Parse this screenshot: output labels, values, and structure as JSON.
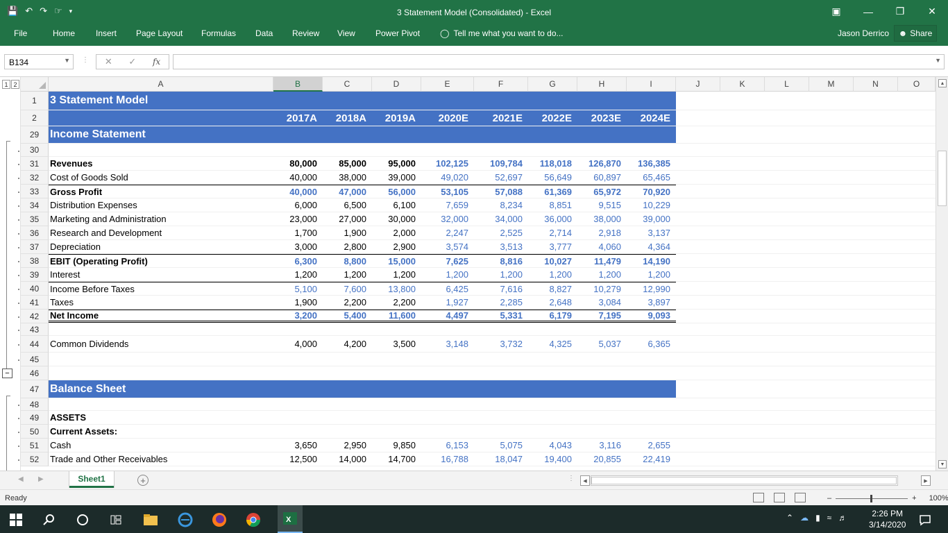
{
  "window": {
    "title": "3 Statement Model (Consolidated)  -  Excel",
    "username": "Jason Derrico",
    "share_label": "Share"
  },
  "ribbon": {
    "tabs": [
      "File",
      "Home",
      "Insert",
      "Page Layout",
      "Formulas",
      "Data",
      "Review",
      "View",
      "Power Pivot"
    ],
    "tell_me": "Tell me what you want to do..."
  },
  "formula_bar": {
    "name_box": "B134",
    "formula": "",
    "fx_label": "fx"
  },
  "outline_levels": [
    "1",
    "2"
  ],
  "columns": [
    "A",
    "B",
    "C",
    "D",
    "E",
    "F",
    "G",
    "H",
    "I",
    "J",
    "K",
    "L",
    "M",
    "N",
    "O"
  ],
  "selected_column": "B",
  "years": [
    "2017A",
    "2018A",
    "2019A",
    "2020E",
    "2021E",
    "2022E",
    "2023E",
    "2024E"
  ],
  "rows": [
    {
      "num": "1",
      "label": "3 Statement Model",
      "kind": "title"
    },
    {
      "num": "2",
      "label": "",
      "kind": "years"
    },
    {
      "num": "29",
      "label": "Income Statement",
      "kind": "section"
    },
    {
      "num": "30",
      "label": "",
      "kind": "blank"
    },
    {
      "num": "31",
      "label": "Revenues",
      "kind": "data",
      "bold": true,
      "values": [
        "80,000",
        "85,000",
        "95,000",
        "102,125",
        "109,784",
        "118,018",
        "126,870",
        "136,385"
      ]
    },
    {
      "num": "32",
      "label": "Cost of Goods Sold",
      "kind": "data",
      "values": [
        "40,000",
        "38,000",
        "39,000",
        "49,020",
        "52,697",
        "56,649",
        "60,897",
        "65,465"
      ]
    },
    {
      "num": "33",
      "label": "Gross Profit",
      "kind": "data",
      "bold": true,
      "subtotal": true,
      "values": [
        "40,000",
        "47,000",
        "56,000",
        "53,105",
        "57,088",
        "61,369",
        "65,972",
        "70,920"
      ]
    },
    {
      "num": "34",
      "label": "Distribution Expenses",
      "kind": "data",
      "values": [
        "6,000",
        "6,500",
        "6,100",
        "7,659",
        "8,234",
        "8,851",
        "9,515",
        "10,229"
      ]
    },
    {
      "num": "35",
      "label": "Marketing and Administration",
      "kind": "data",
      "values": [
        "23,000",
        "27,000",
        "30,000",
        "32,000",
        "34,000",
        "36,000",
        "38,000",
        "39,000"
      ]
    },
    {
      "num": "36",
      "label": "Research and Development",
      "kind": "data",
      "values": [
        "1,700",
        "1,900",
        "2,000",
        "2,247",
        "2,525",
        "2,714",
        "2,918",
        "3,137"
      ]
    },
    {
      "num": "37",
      "label": "Depreciation",
      "kind": "data",
      "values": [
        "3,000",
        "2,800",
        "2,900",
        "3,574",
        "3,513",
        "3,777",
        "4,060",
        "4,364"
      ]
    },
    {
      "num": "38",
      "label": "EBIT (Operating Profit)",
      "kind": "data",
      "bold": true,
      "subtotal": true,
      "values": [
        "6,300",
        "8,800",
        "15,000",
        "7,625",
        "8,816",
        "10,027",
        "11,479",
        "14,190"
      ]
    },
    {
      "num": "39",
      "label": "Interest",
      "kind": "data",
      "values": [
        "1,200",
        "1,200",
        "1,200",
        "1,200",
        "1,200",
        "1,200",
        "1,200",
        "1,200"
      ]
    },
    {
      "num": "40",
      "label": "Income Before Taxes",
      "kind": "data",
      "subtotal": true,
      "values": [
        "5,100",
        "7,600",
        "13,800",
        "6,425",
        "7,616",
        "8,827",
        "10,279",
        "12,990"
      ]
    },
    {
      "num": "41",
      "label": "Taxes",
      "kind": "data",
      "values": [
        "1,900",
        "2,200",
        "2,200",
        "1,927",
        "2,285",
        "2,648",
        "3,084",
        "3,897"
      ]
    },
    {
      "num": "42",
      "label": "Net Income",
      "kind": "data",
      "bold": true,
      "subtotal": true,
      "final": true,
      "values": [
        "3,200",
        "5,400",
        "11,600",
        "4,497",
        "5,331",
        "6,179",
        "7,195",
        "9,093"
      ]
    },
    {
      "num": "43",
      "label": "",
      "kind": "blank"
    },
    {
      "num": "44",
      "label": "Common Dividends",
      "kind": "data",
      "values": [
        "4,000",
        "4,200",
        "3,500",
        "3,148",
        "3,732",
        "4,325",
        "5,037",
        "6,365"
      ]
    },
    {
      "num": "45",
      "label": "",
      "kind": "blank"
    },
    {
      "num": "46",
      "label": "",
      "kind": "blank"
    },
    {
      "num": "47",
      "label": "Balance Sheet",
      "kind": "section"
    },
    {
      "num": "48",
      "label": "",
      "kind": "blank"
    },
    {
      "num": "49",
      "label": "ASSETS",
      "kind": "data",
      "bold": true
    },
    {
      "num": "50",
      "label": "Current Assets:",
      "kind": "data",
      "bold": true
    },
    {
      "num": "51",
      "label": "Cash",
      "kind": "data",
      "values": [
        "3,650",
        "2,950",
        "9,850",
        "6,153",
        "5,075",
        "4,043",
        "3,116",
        "2,655"
      ]
    },
    {
      "num": "52",
      "label": "Trade and Other Receivables",
      "kind": "data",
      "values": [
        "12,500",
        "14,000",
        "14,700",
        "16,788",
        "18,047",
        "19,400",
        "20,855",
        "22,419"
      ]
    }
  ],
  "sheet_tabs": [
    "Sheet1"
  ],
  "status": {
    "ready": "Ready",
    "zoom": "100%"
  },
  "taskbar": {
    "time": "2:26 PM",
    "date": "3/14/2020"
  },
  "colors": {
    "excel_green": "#217346",
    "header_blue": "#4472c4",
    "forecast_blue": "#4472c4"
  }
}
